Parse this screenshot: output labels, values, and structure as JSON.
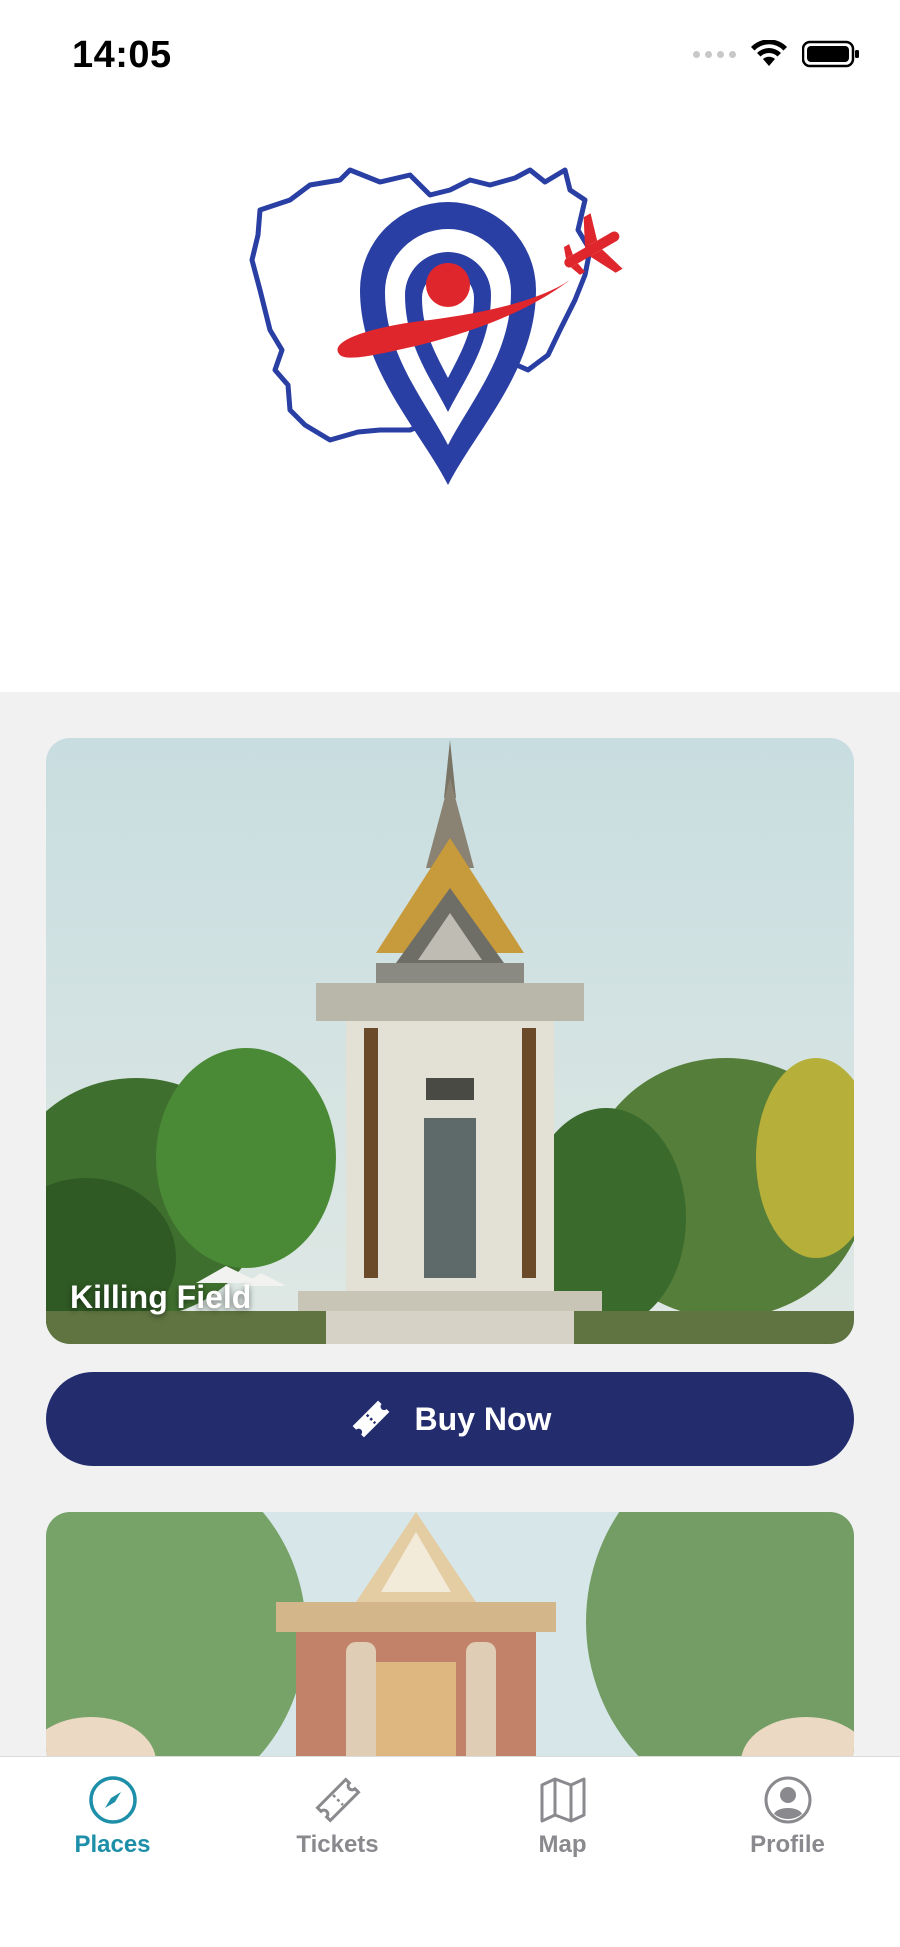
{
  "status_bar": {
    "time": "14:05"
  },
  "places": [
    {
      "title": "Killing Field"
    }
  ],
  "buy_button": {
    "label": "Buy Now"
  },
  "tabs": [
    {
      "label": "Places",
      "icon": "compass-icon",
      "active": true
    },
    {
      "label": "Tickets",
      "icon": "ticket-icon",
      "active": false
    },
    {
      "label": "Map",
      "icon": "map-icon",
      "active": false
    },
    {
      "label": "Profile",
      "icon": "person-icon",
      "active": false
    }
  ],
  "colors": {
    "primary_navy": "#232c6c",
    "accent_teal": "#1d8fa9",
    "logo_blue": "#2a3fa3",
    "logo_red": "#e0262d"
  }
}
